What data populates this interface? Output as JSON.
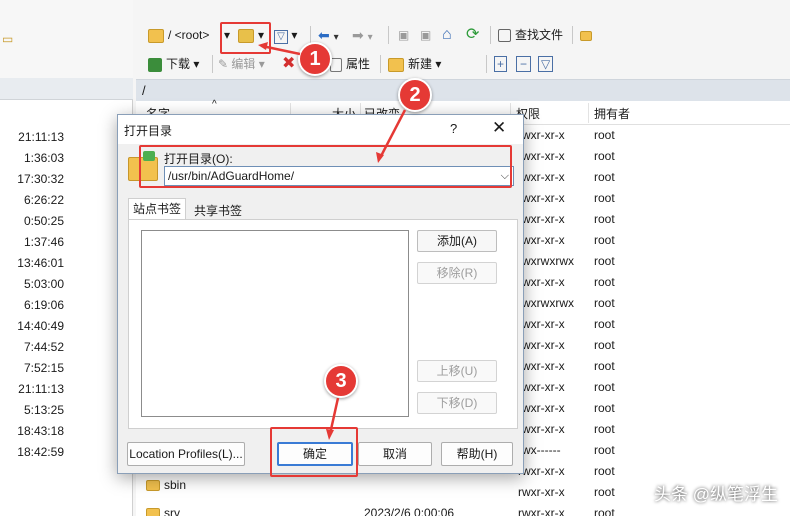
{
  "toolbar": {
    "path_combo": "/ <root>",
    "find_files": "查找文件",
    "download": "下载",
    "edit": "编辑",
    "properties": "属性",
    "new": "新建"
  },
  "left_pane": {
    "times": [
      "21:11:13",
      "1:36:03",
      "17:30:32",
      "6:26:22",
      "0:50:25",
      "1:37:46",
      "13:46:01",
      "5:03:00",
      "6:19:06",
      "14:40:49",
      "7:44:52",
      "7:52:15",
      "21:11:13",
      "5:13:25",
      "18:43:18",
      "18:42:59"
    ]
  },
  "right_pane": {
    "path": "/",
    "columns": {
      "name": "名字",
      "size": "大小",
      "modified": "已改变",
      "permissions": "权限",
      "owner": "拥有者"
    },
    "rows": [
      {
        "perm": "rwxr-xr-x",
        "owner": "root"
      },
      {
        "perm": "rwxr-xr-x",
        "owner": "root"
      },
      {
        "perm": "rwxr-xr-x",
        "owner": "root"
      },
      {
        "perm": "rwxr-xr-x",
        "owner": "root"
      },
      {
        "perm": "rwxr-xr-x",
        "owner": "root"
      },
      {
        "perm": "rwxr-xr-x",
        "owner": "root"
      },
      {
        "perm": "rwxrwxrwx",
        "owner": "root"
      },
      {
        "perm": "rwxr-xr-x",
        "owner": "root"
      },
      {
        "perm": "rwxrwxrwx",
        "owner": "root"
      },
      {
        "perm": "rwxr-xr-x",
        "owner": "root"
      },
      {
        "perm": "rwxr-xr-x",
        "owner": "root"
      },
      {
        "perm": "rwxr-xr-x",
        "owner": "root"
      },
      {
        "perm": "rwxr-xr-x",
        "owner": "root"
      },
      {
        "perm": "rwxr-xr-x",
        "owner": "root"
      },
      {
        "perm": "rwxr-xr-x",
        "owner": "root"
      },
      {
        "perm": "rwx------",
        "owner": "root"
      },
      {
        "perm": "rwxr-xr-x",
        "owner": "root"
      },
      {
        "perm": "rwxr-xr-x",
        "owner": "root"
      }
    ],
    "partial_name_row": "sbin",
    "last_row": {
      "name": "srv",
      "modified": "2023/2/6 0:00:06",
      "perm": "rwxr-xr-x",
      "owner": "root"
    }
  },
  "dialog": {
    "title": "打开目录",
    "help": "?",
    "close": "✕",
    "open_dir_label": "打开目录(O):",
    "path_value": "/usr/bin/AdGuardHome/",
    "tab_site": "站点书签",
    "tab_shared": "共享书签",
    "add": "添加(A)",
    "remove": "移除(R)",
    "move_up": "上移(U)",
    "move_down": "下移(D)",
    "location_profiles": "Location Profiles(L)...",
    "ok": "确定",
    "cancel": "取消",
    "help_btn": "帮助(H)"
  },
  "annotations": {
    "step1": "1",
    "step2": "2",
    "step3": "3"
  },
  "watermark": "头条 @纵笔浮生",
  "colors": {
    "accent_red": "#e53935",
    "dialog_border": "#8a9fb8",
    "folder": "#f2c14e"
  }
}
